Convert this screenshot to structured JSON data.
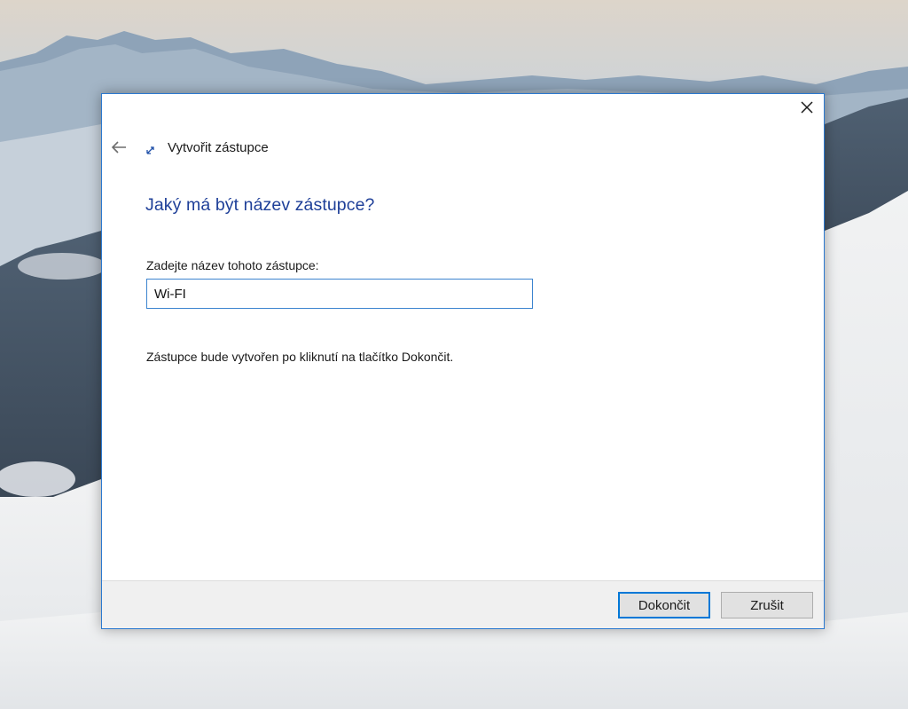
{
  "dialog": {
    "title": "Vytvořit zástupce",
    "heading": "Jaký má být název zástupce?",
    "field_label": "Zadejte název tohoto zástupce:",
    "name_value": "Wi-FI",
    "info": "Zástupce bude vytvořen po kliknutí na tlačítko Dokončit.",
    "finish_label": "Dokončit",
    "cancel_label": "Zrušit"
  },
  "icons": {
    "close": "close-icon",
    "back": "back-arrow-icon",
    "shortcut": "shortcut-icon"
  },
  "colors": {
    "heading": "#1e3f98",
    "accent_border": "#0078d7",
    "footer_bg": "#f0f0f0"
  }
}
